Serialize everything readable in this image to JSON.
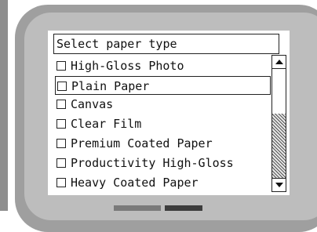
{
  "dialog": {
    "header": "Select paper type"
  },
  "items": [
    {
      "label": "High-Gloss Photo",
      "selected": false
    },
    {
      "label": "Plain Paper",
      "selected": true
    },
    {
      "label": "Canvas",
      "selected": false
    },
    {
      "label": "Clear Film",
      "selected": false
    },
    {
      "label": "Premium Coated Paper",
      "selected": false
    },
    {
      "label": "Productivity High-Gloss",
      "selected": false
    },
    {
      "label": "Heavy Coated Paper",
      "selected": false
    }
  ],
  "colors": {
    "bezel_outer": "#9f9f9f",
    "bezel_inner": "#bdbdbd",
    "screen_bg": "#ffffff",
    "text": "#111111"
  }
}
